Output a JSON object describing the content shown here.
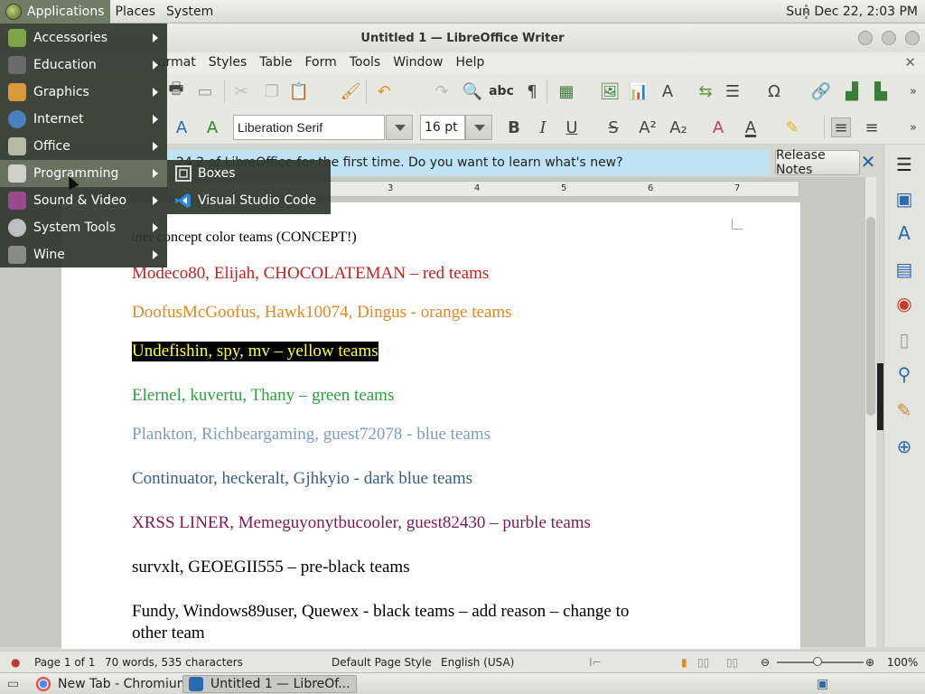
{
  "top_panel": {
    "applications": "Applications",
    "places": "Places",
    "system": "System",
    "clock": "Sun Dec 22,  2:03 PM"
  },
  "apps_menu": {
    "items": [
      {
        "label": "Accessories",
        "icon": "accessories-icon",
        "color": "#7fa548"
      },
      {
        "label": "Education",
        "icon": "education-icon",
        "color": "#6b6b6b"
      },
      {
        "label": "Graphics",
        "icon": "graphics-icon",
        "color": "#d89a3a"
      },
      {
        "label": "Internet",
        "icon": "internet-icon",
        "color": "#4a7fbf"
      },
      {
        "label": "Office",
        "icon": "office-icon",
        "color": "#b9b9a8"
      },
      {
        "label": "Programming",
        "icon": "programming-icon",
        "color": "#d0d0c8"
      },
      {
        "label": "Sound & Video",
        "icon": "sound-video-icon",
        "color": "#9a4a8f"
      },
      {
        "label": "System Tools",
        "icon": "system-tools-icon",
        "color": "#bfbfbf"
      },
      {
        "label": "Wine",
        "icon": "wine-icon",
        "color": "#8a8a86"
      }
    ],
    "selected_index": 5
  },
  "submenu": {
    "items": [
      {
        "label": "Boxes",
        "icon": "boxes-icon"
      },
      {
        "label": "Visual Studio Code",
        "icon": "vscode-icon"
      }
    ]
  },
  "window": {
    "title": "Untitled 1 — LibreOffice Writer"
  },
  "menubar": {
    "items": [
      "ormat",
      "Styles",
      "Table",
      "Form",
      "Tools",
      "Window",
      "Help"
    ]
  },
  "formatting": {
    "font_name": "Liberation Serif",
    "font_size": "16 pt"
  },
  "infobar": {
    "message": "24.2 of LibreOffice for the first time. Do you want to learn what's new?",
    "release_notes": "Release Notes"
  },
  "ruler": {
    "numbers": [
      "3",
      "4",
      "5",
      "6",
      "7"
    ]
  },
  "document": {
    "lines": [
      {
        "text": "iner concept color teams (CONCEPT!)",
        "color": "#000000",
        "bg": ""
      },
      {
        "text": "Modeco80, Elijah, CHOCOLATEMAN – red teams",
        "color": "#c9211e",
        "bg": ""
      },
      {
        "text": "DoofusMcGoofus, Hawk10074, Dingus - orange teams",
        "color": "#e8861f",
        "bg": ""
      },
      {
        "text": "Undefishin, spy, mv – yellow teams",
        "color": "#ffff38",
        "bg": "#000000"
      },
      {
        "text": "Elernel, kuvertu, Thany – green teams",
        "color": "#2aa33c",
        "bg": ""
      },
      {
        "text": "Plankton, Richbeargaming, guest72078 - blue teams",
        "color": "#7e9cc4",
        "bg": ""
      },
      {
        "text": "Continuator, heckeralt, Gjhkyio - dark blue teams",
        "color": "#355e8a",
        "bg": ""
      },
      {
        "text": "XRSS LINER, Memeguyonytbucooler, guest82430 – purble teams",
        "color": "#7b1a52",
        "bg": ""
      },
      {
        "text": "survxlt, GEOEGII555 – pre-black teams",
        "color": "#000000",
        "bg": ""
      },
      {
        "text": "Fundy, Windows89user, Quewex - black teams – add reason – change to",
        "color": "#000000",
        "bg": ""
      },
      {
        "text": "other team",
        "color": "#000000",
        "bg": ""
      }
    ]
  },
  "statusbar": {
    "page": "Page 1 of 1",
    "words": "70 words, 535 characters",
    "page_style": "Default Page Style",
    "language": "English (USA)",
    "zoom": "100%"
  },
  "taskbar": {
    "items": [
      {
        "label": "New Tab - Chromium"
      },
      {
        "label": "Untitled 1 — LibreOf..."
      }
    ]
  }
}
